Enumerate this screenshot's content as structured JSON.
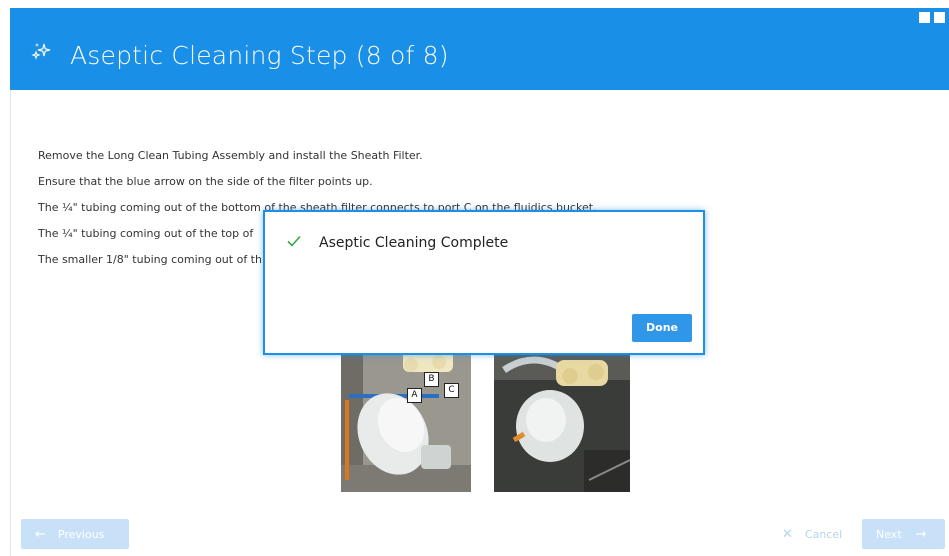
{
  "header": {
    "title": "Aseptic Cleaning Step (8 of 8)",
    "icon": "sparkle-icon",
    "background_color": "#1a8fe8"
  },
  "instructions": [
    "Remove the Long Clean Tubing Assembly and install the Sheath Filter.",
    "Ensure that the blue arrow on the side of the filter points up.",
    "The ¼\" tubing coming out of the bottom of the sheath filter connects to port C on the fluidics bucket.",
    "The ¼\" tubing coming out of the top of",
    "The smaller 1/8\" tubing coming out of th"
  ],
  "photos": {
    "left_ports": [
      "A",
      "B",
      "C"
    ]
  },
  "modal": {
    "title": "Aseptic Cleaning Complete",
    "icon": "check-icon",
    "done_label": "Done",
    "accent_color": "#1f8fe6"
  },
  "footer": {
    "previous_label": "Previous",
    "cancel_label": "Cancel",
    "next_label": "Next"
  }
}
